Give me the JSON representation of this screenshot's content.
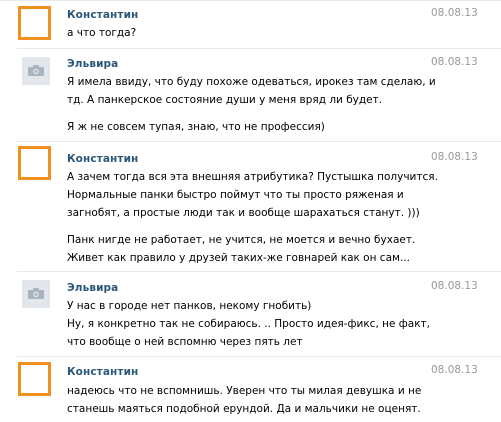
{
  "messages": [
    {
      "author": "Константин",
      "date": "08.08.13",
      "avatar": "orange-frame",
      "lines": [
        "а что тогда?"
      ]
    },
    {
      "author": "Эльвира",
      "date": "08.08.13",
      "avatar": "camera-icon",
      "lines": [
        "Я имела ввиду, что буду похоже одеваться, ирокез там сделаю, и",
        "тд. А панкерское состояние души у меня вряд ли будет.",
        "Я ж не совсем тупая, знаю, что не профессия)"
      ]
    },
    {
      "author": "Константин",
      "date": "08.08.13",
      "avatar": "orange-frame",
      "lines": [
        "А зачем тогда вся эта внешняя атрибутика? Пустышка получится.",
        "Нормальные панки быстро поймут что ты просто ряженая и",
        "загнобят, а простые люди так и вообще шарахаться станут. )))",
        "Панк нигде не работает, не учится, не моется и вечно бухает.",
        "Живет как правило у друзей таких-же говнарей как он сам..."
      ]
    },
    {
      "author": "Эльвира",
      "date": "08.08.13",
      "avatar": "camera-icon",
      "lines": [
        "У нас в городе нет панков, некому гнобить)",
        "Ну, я конкретно так не собираюсь. .. Просто идея-фикс, не факт,",
        "что вообще о ней вспомню через пять лет"
      ]
    },
    {
      "author": "Константин",
      "date": "08.08.13",
      "avatar": "orange-frame",
      "lines": [
        "надеюсь что не вспомнишь. Уверен что ты милая девушка и не",
        "станешь маяться подобной ерундой. Да и мальчики не оценят."
      ]
    }
  ],
  "colors": {
    "author": "#2b587a",
    "date": "#999999",
    "avatar_frame": "#f0901e",
    "camera_bg": "#e3e7ec",
    "camera_icon": "#a9b4bf",
    "divider": "#e7eaed"
  }
}
